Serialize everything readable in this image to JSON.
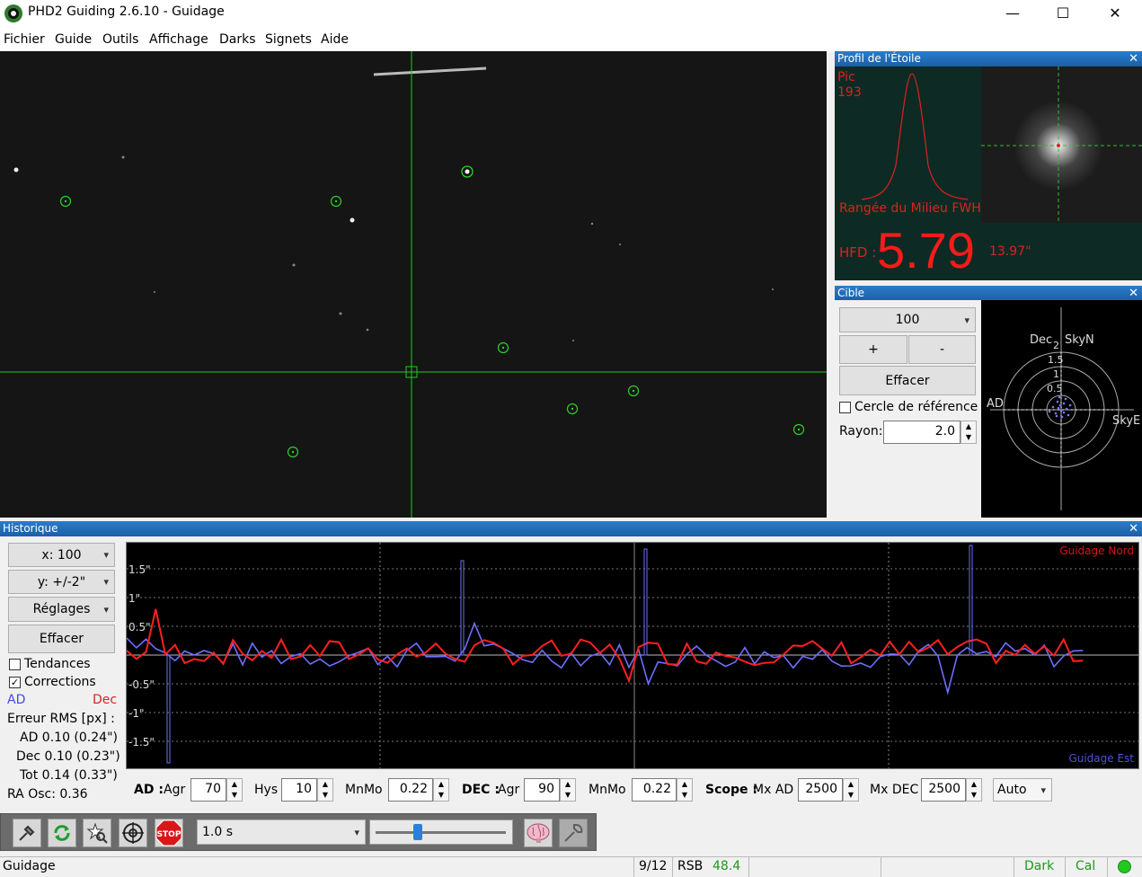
{
  "window": {
    "title": "PHD2 Guiding 2.6.10 - Guidage",
    "minimize": "—",
    "maximize": "☐",
    "close": "✕"
  },
  "menu": [
    "Fichier",
    "Guide",
    "Outils",
    "Affichage",
    "Darks",
    "Signets",
    "Aide"
  ],
  "star_profile": {
    "title": "Profil de l'Étoile",
    "peak_label": "Pic",
    "peak_value": "193",
    "mid_row_label": "Rangée du Milieu FWHM",
    "hfd_label": "HFD :",
    "hfd_value": "5.79",
    "hfd_arcsec": "13.97\""
  },
  "target": {
    "title": "Cible",
    "zoom_value": "100",
    "plus": "+",
    "minus": "-",
    "clear": "Effacer",
    "ref_circle_label": "Cercle de référence",
    "ref_circle_checked": false,
    "radius_label": "Rayon:",
    "radius_value": "2.0",
    "labels": {
      "dec": "Dec",
      "skyn": "SkyN",
      "ad": "AD",
      "skye": "SkyE",
      "r2": "2",
      "r15": "1.5",
      "r1": "1",
      "r05": "0.5"
    }
  },
  "history": {
    "title": "Historique",
    "x_scale": "x: 100",
    "y_scale": "y: +/-2\"",
    "settings": "Réglages",
    "clear": "Effacer",
    "trends_label": "Tendances",
    "trends_checked": false,
    "corrections_label": "Corrections",
    "corrections_checked": true,
    "legend_ra": "AD",
    "legend_dec": "Dec",
    "rms_title": "Erreur RMS [px] :",
    "rms_ra": "AD 0.10 (0.24\")",
    "rms_dec": "Dec 0.10 (0.23\")",
    "rms_tot": "Tot 0.14 (0.33\")",
    "ra_osc": "RA Osc: 0.36",
    "guide_north": "Guidage Nord",
    "guide_east": "Guidage Est",
    "y_labels": [
      "1.5\"",
      "1\"",
      "0.5\"",
      "-0.5\"",
      "-1\"",
      "-1.5\""
    ],
    "colors": {
      "ra": "#6e6eff",
      "dec": "#ff2020"
    }
  },
  "params": {
    "ad_label": "AD :",
    "agr_label": "Agr",
    "ad_agr": "70",
    "hys_label": "Hys",
    "hys": "10",
    "mnmo_label": "MnMo",
    "ad_mnmo": "0.22",
    "dec_label": "DEC :",
    "dec_agr": "90",
    "dec_mnmo": "0.22",
    "scope_label": "Scope :",
    "mx_ad_label": "Mx AD",
    "mx_ad": "2500",
    "mx_dec_label": "Mx DEC",
    "mx_dec": "2500",
    "dec_mode": "Auto"
  },
  "toolbar": {
    "exposure": "1.0 s",
    "stop": "STOP"
  },
  "status": {
    "state": "Guidage",
    "frame": "9/12",
    "snr_label": "RSB",
    "snr_value": "48.4",
    "dark": "Dark",
    "cal": "Cal"
  }
}
